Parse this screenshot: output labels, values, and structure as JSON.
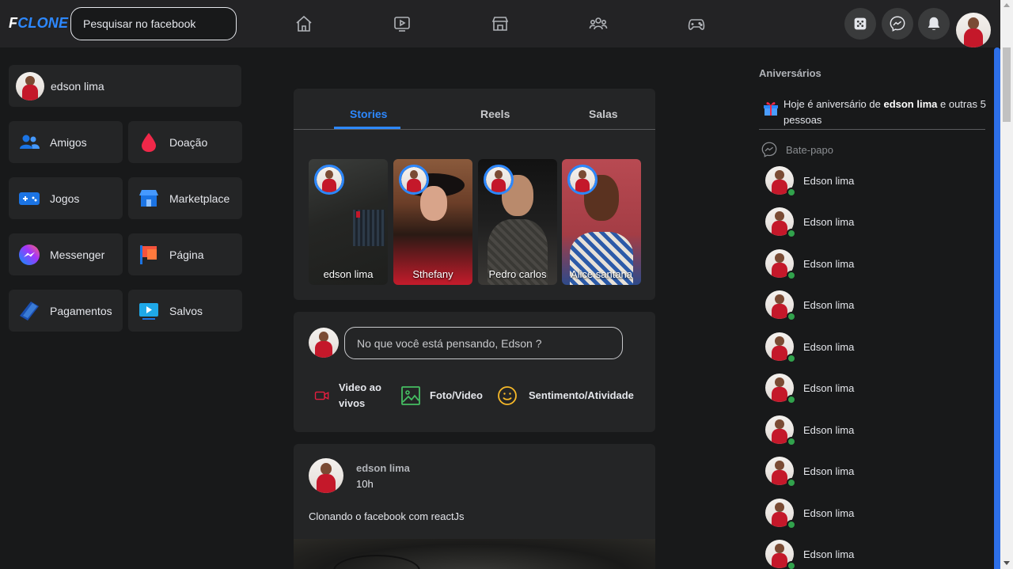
{
  "header": {
    "logo_f": "F",
    "logo_clone": "CLONE",
    "search_placeholder": "Pesquisar no facebook",
    "nav_icons": [
      "home-icon",
      "video-icon",
      "marketplace-icon",
      "groups-icon",
      "gaming-icon"
    ],
    "right_buttons": [
      "menu-icon",
      "messenger-icon",
      "notifications-icon"
    ]
  },
  "left": {
    "profile_name": "edson lima",
    "tiles": [
      {
        "label": "Amigos",
        "icon": "friends-icon"
      },
      {
        "label": "Doação",
        "icon": "donation-icon"
      },
      {
        "label": "Jogos",
        "icon": "games-icon"
      },
      {
        "label": "Marketplace",
        "icon": "marketplace-icon"
      },
      {
        "label": "Messenger",
        "icon": "messenger-icon"
      },
      {
        "label": "Página",
        "icon": "page-flag-icon"
      },
      {
        "label": "Pagamentos",
        "icon": "payments-icon"
      },
      {
        "label": "Salvos",
        "icon": "saved-icon"
      }
    ]
  },
  "stories": {
    "tabs": [
      "Stories",
      "Reels",
      "Salas"
    ],
    "active_tab": "Stories",
    "items": [
      {
        "name": "edson lima"
      },
      {
        "name": "Sthefany"
      },
      {
        "name": "Pedro carlos"
      },
      {
        "name": "Alice santana"
      }
    ]
  },
  "composer": {
    "placeholder": "No que você está pensando, Edson ?",
    "actions": [
      {
        "label": "Video ao vivos",
        "line1": "Video ao",
        "line2": "vivos",
        "icon": "live-video-icon",
        "color": "#e41e3f"
      },
      {
        "label": "Foto/Video",
        "icon": "photo-icon",
        "color": "#45bd62"
      },
      {
        "label": "Sentimento/Atividade",
        "icon": "feeling-icon",
        "color": "#f7b928"
      }
    ]
  },
  "post": {
    "author": "edson lima",
    "time": "10h",
    "text": "Clonando o facebook com reactJs"
  },
  "right": {
    "birthdays_title": "Aniversários",
    "birthday_prefix": "Hoje é aniversário de ",
    "birthday_name": "edson lima",
    "birthday_suffix": " e outras 5 pessoas",
    "chat_title": "Bate-papo",
    "contacts": [
      "Edson lima",
      "Edson lima",
      "Edson lima",
      "Edson lima",
      "Edson lima",
      "Edson lima",
      "Edson lima",
      "Edson lima",
      "Edson lima",
      "Edson lima"
    ]
  },
  "colors": {
    "accent": "#2d88ff",
    "online": "#31a24c",
    "background": "#18191a",
    "card": "#242526"
  }
}
